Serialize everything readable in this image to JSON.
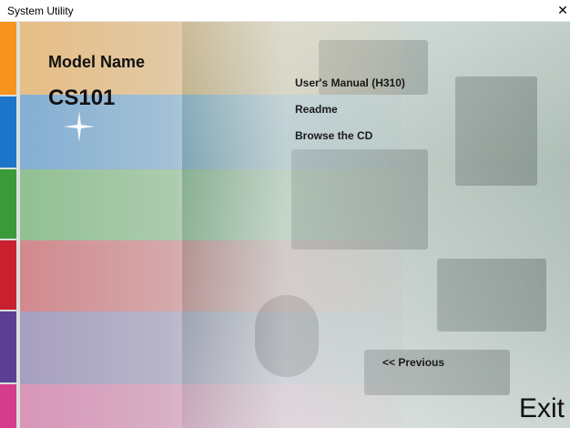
{
  "window": {
    "title": "System Utility",
    "close_glyph": "✕"
  },
  "model": {
    "heading": "Model Name",
    "name": "CS101"
  },
  "menu": {
    "items": [
      {
        "label": "User's Manual (H310)"
      },
      {
        "label": "Readme"
      },
      {
        "label": "Browse the CD"
      }
    ]
  },
  "nav": {
    "previous_label": "<< Previous",
    "exit_label": "Exit"
  },
  "colors": {
    "orange": "#f7941d",
    "blue": "#1c75c8",
    "green": "#3a9a3a",
    "red": "#c8202f",
    "purple": "#5b3f94",
    "pink": "#d63c8c"
  },
  "icons": {
    "close": "close-icon",
    "sparkle": "sparkle-icon"
  }
}
